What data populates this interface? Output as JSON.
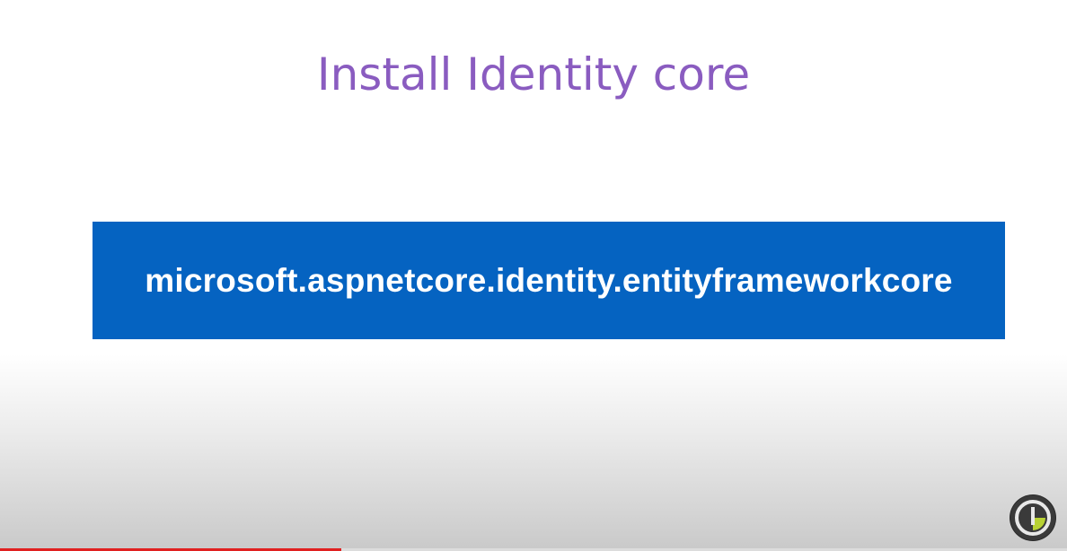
{
  "slide": {
    "title": "Install Identity core",
    "package_name": "microsoft.aspnetcore.identity.entityframeworkcore"
  },
  "colors": {
    "title": "#8a5cc0",
    "package_box_bg": "#0563c1",
    "package_text": "#ffffff",
    "progress": "#e02020",
    "logo_ring": "#e8e8e8",
    "logo_accent": "#b8d233"
  },
  "video": {
    "progress_fraction": 0.32
  },
  "icons": {
    "logo": "channel-logo-icon"
  }
}
